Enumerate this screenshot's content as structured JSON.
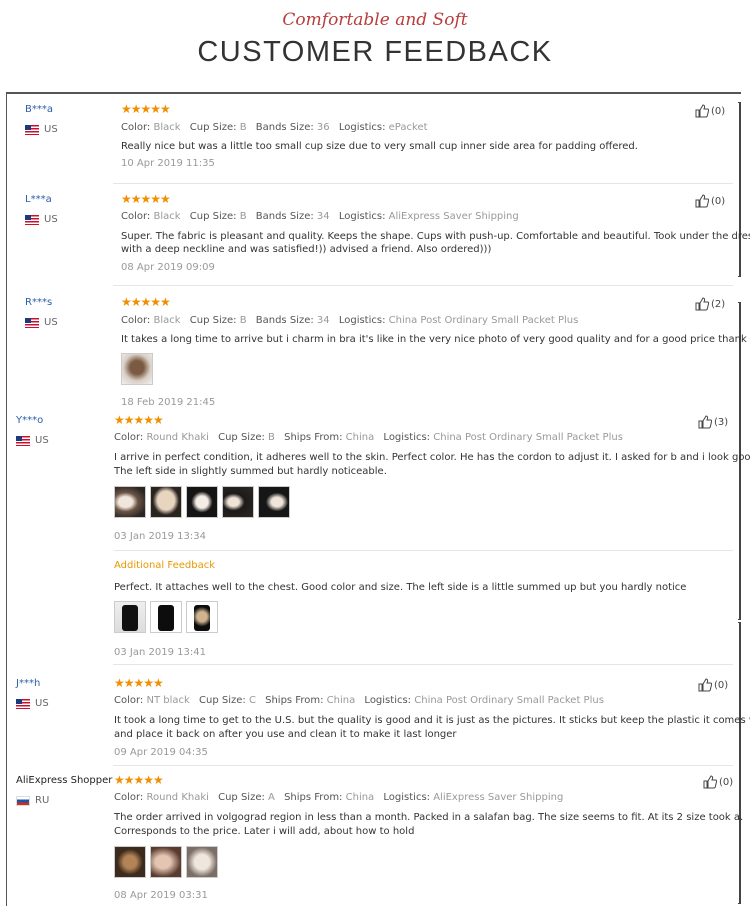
{
  "header": {
    "subtitle": "Comfortable and Soft",
    "title": "CUSTOMER FEEDBACK"
  },
  "reviews": [
    {
      "user": "B***a",
      "country": "US",
      "stars": "★★★★★",
      "helpful": "(0)",
      "attrs": [
        {
          "label": "Color:",
          "value": "Black"
        },
        {
          "label": "Cup Size:",
          "value": "B"
        },
        {
          "label": "Bands Size:",
          "value": "36"
        },
        {
          "label": "Logistics:",
          "value": "ePacket"
        }
      ],
      "text": [
        "Really nice but was a little too small cup size due to very small cup inner side area for padding offered."
      ],
      "date": "10 Apr 2019 11:35"
    },
    {
      "user": "L***a",
      "country": "US",
      "stars": "★★★★★",
      "helpful": "(0)",
      "attrs": [
        {
          "label": "Color:",
          "value": "Black"
        },
        {
          "label": "Cup Size:",
          "value": "B"
        },
        {
          "label": "Bands Size:",
          "value": "34"
        },
        {
          "label": "Logistics:",
          "value": "AliExpress Saver Shipping"
        }
      ],
      "text": [
        "Super. The fabric is pleasant and quality. Keeps the shape. Cups with push-up. Comfortable and beautiful. Took under the dress",
        "with a deep neckline and was satisfied!)) advised a friend. Also ordered)))"
      ],
      "date": "08 Apr 2019 09:09"
    },
    {
      "user": "R***s",
      "country": "US",
      "stars": "★★★★★",
      "helpful": "(2)",
      "attrs": [
        {
          "label": "Color:",
          "value": "Black"
        },
        {
          "label": "Cup Size:",
          "value": "B"
        },
        {
          "label": "Bands Size:",
          "value": "34"
        },
        {
          "label": "Logistics:",
          "value": "China Post Ordinary Small Packet Plus"
        }
      ],
      "text": [
        "It takes a long time to arrive but i charm in bra it's like in the very nice photo of very good quality and for a good price thank you"
      ],
      "date": "18 Feb 2019 21:45"
    },
    {
      "user": "Y***o",
      "country": "US",
      "stars": "★★★★★",
      "helpful": "(3)",
      "attrs": [
        {
          "label": "Color:",
          "value": "Round Khaki"
        },
        {
          "label": "Cup Size:",
          "value": "B"
        },
        {
          "label": "Ships From:",
          "value": "China"
        },
        {
          "label": "Logistics:",
          "value": "China Post Ordinary Small Packet Plus"
        }
      ],
      "text": [
        "I arrive in perfect condition, it adheres well to the skin. Perfect color. He has the cordon to adjust it. I asked for b and i look good.",
        "The left side in slightly summed but hardly noticeable."
      ],
      "date": "03 Jan 2019 13:34",
      "additional_label": "Additional Feedback",
      "additional_text": "Perfect. It attaches well to the chest. Good color and size. The left side is a little summed up but you hardly notice",
      "additional_date": "03 Jan 2019 13:41"
    },
    {
      "user": "J***h",
      "country": "US",
      "stars": "★★★★★",
      "helpful": "(0)",
      "attrs": [
        {
          "label": "Color:",
          "value": "NT black"
        },
        {
          "label": "Cup Size:",
          "value": "C"
        },
        {
          "label": "Ships From:",
          "value": "China"
        },
        {
          "label": "Logistics:",
          "value": "China Post Ordinary Small Packet Plus"
        }
      ],
      "text": [
        "It took a long time to get to the U.S. but the quality is good and it is just as the pictures. It sticks but keep the plastic it comes with",
        "and place it back on after you use and clean it to make it last longer"
      ],
      "date": "09 Apr 2019 04:35"
    },
    {
      "user": "AliExpress Shopper",
      "country": "RU",
      "stars": "★★★★★",
      "helpful": "(0)",
      "attrs": [
        {
          "label": "Color:",
          "value": "Round Khaki"
        },
        {
          "label": "Cup Size:",
          "value": "A"
        },
        {
          "label": "Ships From:",
          "value": "China"
        },
        {
          "label": "Logistics:",
          "value": "AliExpress Saver Shipping"
        }
      ],
      "text": [
        "The order arrived in volgograd region in less than a month. Packed in a salafan bag. The size seems to fit. At its 2 size took a.",
        "Corresponds to the price. Later i will add, about how to hold"
      ],
      "date": "08 Apr 2019 03:31"
    }
  ]
}
